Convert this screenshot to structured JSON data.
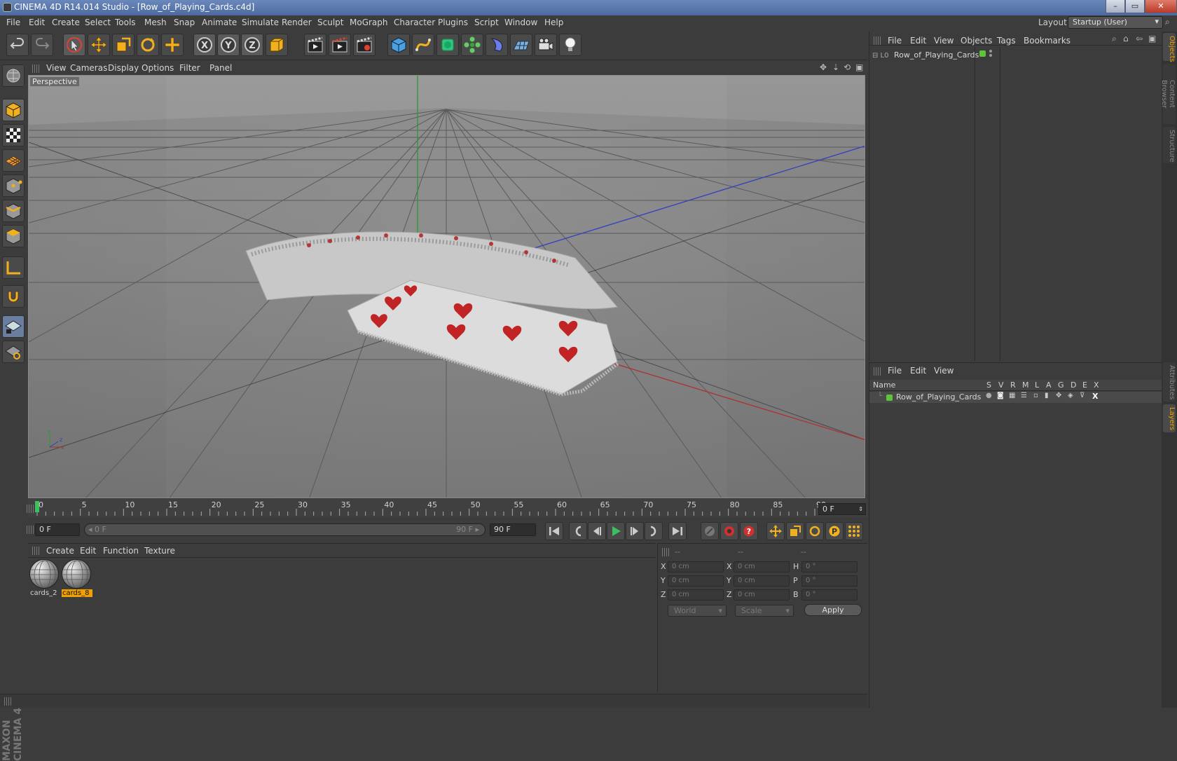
{
  "window": {
    "title": "CINEMA 4D R14.014 Studio - [Row_of_Playing_Cards.c4d]",
    "minimize": "–",
    "maximize": "▭",
    "close": "✕"
  },
  "menubar": {
    "items": [
      "File",
      "Edit",
      "Create",
      "Select",
      "Tools",
      "Mesh",
      "Snap",
      "Animate",
      "Simulate",
      "Render",
      "Sculpt",
      "MoGraph",
      "Character",
      "Plugins",
      "Script",
      "Window",
      "Help"
    ],
    "layout_label": "Layout:",
    "layout_value": "Startup (User)"
  },
  "toolbar": {
    "icons": [
      "undo-icon",
      "redo-icon",
      "live-selection-icon",
      "move-icon",
      "scale-icon",
      "rotate-icon",
      "add-icon",
      "x-axis-icon",
      "y-axis-icon",
      "z-axis-icon",
      "coordinate-system-icon",
      "render-view-icon",
      "render-picture-viewer-icon",
      "edit-render-settings-icon",
      "cube-icon",
      "spline-icon",
      "nurbs-icon",
      "array-icon",
      "deformer-icon",
      "floor-icon",
      "camera-icon",
      "light-icon"
    ],
    "axis_x": "X",
    "axis_y": "Y",
    "axis_z": "Z"
  },
  "viewport": {
    "menu": [
      "View",
      "Cameras",
      "Display",
      "Options",
      "Filter",
      "Panel"
    ],
    "label": "Perspective"
  },
  "timeline": {
    "ticks": [
      "0",
      "5",
      "10",
      "15",
      "20",
      "25",
      "30",
      "35",
      "40",
      "45",
      "50",
      "55",
      "60",
      "65",
      "70",
      "75",
      "80",
      "85",
      "90"
    ],
    "current_frame": "0 F",
    "max_frames": 90
  },
  "anim": {
    "start_field": "0 F",
    "range_start": "◂ 0 F",
    "range_end": "90 F ▸",
    "end_field": "90 F"
  },
  "materials": {
    "menu": [
      "Create",
      "Edit",
      "Function",
      "Texture"
    ],
    "items": [
      {
        "label": "cards_2",
        "selected": false
      },
      {
        "label": "cards_8",
        "selected": true
      }
    ]
  },
  "coords": {
    "headers": [
      "--",
      "--",
      "--"
    ],
    "rows": [
      {
        "l1": "X",
        "v1": "0 cm",
        "l2": "X",
        "v2": "0 cm",
        "l3": "H",
        "v3": "0 °"
      },
      {
        "l1": "Y",
        "v1": "0 cm",
        "l2": "Y",
        "v2": "0 cm",
        "l3": "P",
        "v3": "0 °"
      },
      {
        "l1": "Z",
        "v1": "0 cm",
        "l2": "Z",
        "v2": "0 cm",
        "l3": "B",
        "v3": "0 °"
      }
    ],
    "world": "World",
    "scale": "Scale",
    "apply": "Apply"
  },
  "objects": {
    "menu": [
      "File",
      "Edit",
      "View",
      "Objects",
      "Tags",
      "Bookmarks"
    ],
    "item": "Row_of_Playing_Cards",
    "item_color": "#5fc43a"
  },
  "layers": {
    "menu": [
      "File",
      "Edit",
      "View"
    ],
    "columns": [
      "Name",
      "S",
      "V",
      "R",
      "M",
      "L",
      "A",
      "G",
      "D",
      "E",
      "X"
    ],
    "item": "Row_of_Playing_Cards",
    "item_color": "#5fc43a"
  },
  "right_tabs": [
    "Objects",
    "Content Browser",
    "Structure",
    "Attributes",
    "Layers"
  ],
  "logo": "MAXON CINEMA 4D",
  "colors": {
    "accent": "#f0a000",
    "x_axis": "#b03030",
    "y_axis": "#2a9a2a",
    "z_axis": "#3040c0"
  }
}
